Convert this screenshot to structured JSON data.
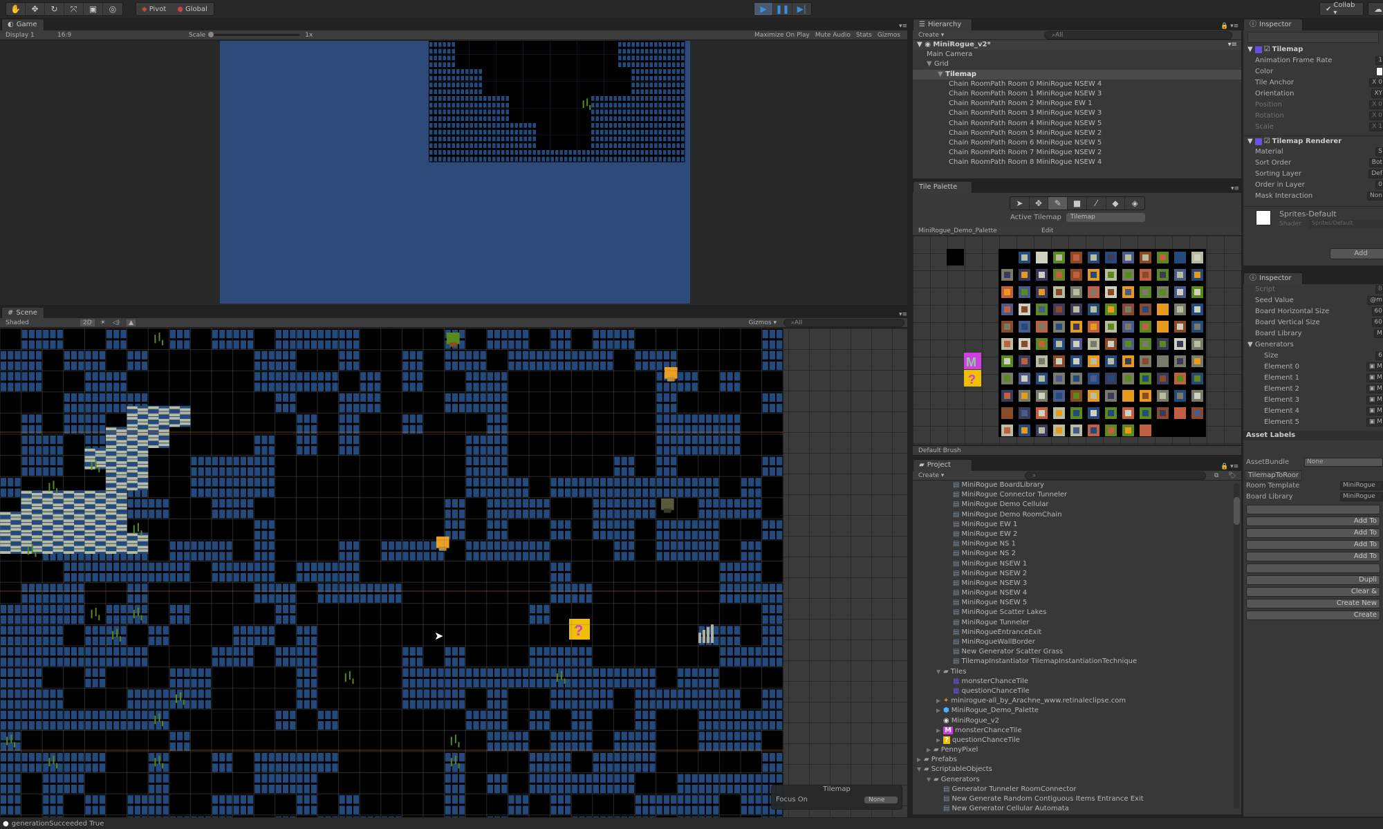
{
  "toolbar": {
    "tools": [
      "hand-tool",
      "move-tool",
      "rotate-tool",
      "scale-tool",
      "rect-tool",
      "transform-tool"
    ],
    "pivot_label": "Pivot",
    "global_label": "Global",
    "collab_label": "Collab ▾"
  },
  "game": {
    "tab_label": "Game",
    "display": "Display 1",
    "aspect": "16:9",
    "scale_label": "Scale",
    "scale_value": "1x",
    "maximize_label": "Maximize On Play",
    "mute_label": "Mute Audio",
    "stats_label": "Stats",
    "gizmos_label": "Gizmos",
    "bg_color": "#2d4a78"
  },
  "scene": {
    "tab_label": "Scene",
    "shading": "Shaded",
    "mode_2d": "2D",
    "gizmos_label": "Gizmos ▾",
    "search_placeholder": "All",
    "overlay_title": "Tilemap",
    "focus_label": "Focus On",
    "focus_value": "None"
  },
  "hierarchy": {
    "tab_label": "Hierarchy",
    "create_label": "Create ▾",
    "search_placeholder": "All",
    "scene_name": "MiniRogue_v2*",
    "items": [
      {
        "label": "Main Camera",
        "level": 1
      },
      {
        "label": "Grid",
        "level": 1,
        "expanded": true
      },
      {
        "label": "Tilemap",
        "level": 2,
        "expanded": true,
        "selected": true
      },
      {
        "label": "Chain RoomPath Room 0 MiniRogue NSEW 4",
        "level": 3
      },
      {
        "label": "Chain RoomPath Room 1 MiniRogue NSEW 3",
        "level": 3
      },
      {
        "label": "Chain RoomPath Room 2 MiniRogue EW 1",
        "level": 3
      },
      {
        "label": "Chain RoomPath Room 3 MiniRogue NSEW 3",
        "level": 3
      },
      {
        "label": "Chain RoomPath Room 4 MiniRogue NSEW 5",
        "level": 3
      },
      {
        "label": "Chain RoomPath Room 5 MiniRogue NSEW 2",
        "level": 3
      },
      {
        "label": "Chain RoomPath Room 6 MiniRogue NSEW 5",
        "level": 3
      },
      {
        "label": "Chain RoomPath Room 7 MiniRogue NSEW 2",
        "level": 3
      },
      {
        "label": "Chain RoomPath Room 8 MiniRogue NSEW 4",
        "level": 3
      }
    ]
  },
  "tile_palette": {
    "tab_label": "Tile Palette",
    "tools": [
      "select-tool",
      "move-tool",
      "paint-brush-tool",
      "box-fill-tool",
      "picker-tool",
      "eraser-tool",
      "fill-tool"
    ],
    "active_tilemap_label": "Active Tilemap",
    "active_tilemap_value": "Tilemap",
    "palette_name": "MiniRogue_Demo_Palette",
    "edit_label": "Edit",
    "brush_label": "Default Brush"
  },
  "project": {
    "tab_label": "Project",
    "create_label": "Create ▾",
    "items": [
      {
        "label": "MiniRogue BoardLibrary",
        "indent": 3,
        "icon": "asset"
      },
      {
        "label": "MiniRogue Connector Tunneler",
        "indent": 3,
        "icon": "asset"
      },
      {
        "label": "MiniRogue Demo Cellular",
        "indent": 3,
        "icon": "asset"
      },
      {
        "label": "MiniRogue Demo RoomChain",
        "indent": 3,
        "icon": "asset"
      },
      {
        "label": "MiniRogue EW 1",
        "indent": 3,
        "icon": "asset"
      },
      {
        "label": "MiniRogue EW 2",
        "indent": 3,
        "icon": "asset"
      },
      {
        "label": "MiniRogue NS 1",
        "indent": 3,
        "icon": "asset"
      },
      {
        "label": "MiniRogue NS 2",
        "indent": 3,
        "icon": "asset"
      },
      {
        "label": "MiniRogue NSEW 1",
        "indent": 3,
        "icon": "asset"
      },
      {
        "label": "MiniRogue NSEW 2",
        "indent": 3,
        "icon": "asset"
      },
      {
        "label": "MiniRogue NSEW 3",
        "indent": 3,
        "icon": "asset"
      },
      {
        "label": "MiniRogue NSEW 4",
        "indent": 3,
        "icon": "asset"
      },
      {
        "label": "MiniRogue NSEW 5",
        "indent": 3,
        "icon": "asset"
      },
      {
        "label": "MiniRogue Scatter Lakes",
        "indent": 3,
        "icon": "asset"
      },
      {
        "label": "MiniRogue Tunneler",
        "indent": 3,
        "icon": "asset"
      },
      {
        "label": "MiniRogueEntranceExit",
        "indent": 3,
        "icon": "asset"
      },
      {
        "label": "MiniRogueWallBorder",
        "indent": 3,
        "icon": "asset"
      },
      {
        "label": "New Generator Scatter Grass",
        "indent": 3,
        "icon": "asset"
      },
      {
        "label": "TilemapInstantiator TilemapInstantiationTechnique",
        "indent": 3,
        "icon": "asset"
      },
      {
        "label": "Tiles",
        "indent": 2,
        "icon": "folder",
        "arrow": "▼"
      },
      {
        "label": "monsterChanceTile",
        "indent": 3,
        "icon": "tile"
      },
      {
        "label": "questionChanceTile",
        "indent": 3,
        "icon": "tile"
      },
      {
        "label": "minirogue-all_by_Arachne_www.retinaleclipse.com",
        "indent": 2,
        "icon": "sprite",
        "arrow": "▶"
      },
      {
        "label": "MiniRogue_Demo_Palette",
        "indent": 2,
        "icon": "prefab",
        "arrow": "▶"
      },
      {
        "label": "MiniRogue_v2",
        "indent": 2,
        "icon": "scene"
      },
      {
        "label": "monsterChanceTile",
        "indent": 2,
        "icon": "m-tile",
        "arrow": "▶"
      },
      {
        "label": "questionChanceTile",
        "indent": 2,
        "icon": "q-tile",
        "arrow": "▶"
      },
      {
        "label": "PennyPixel",
        "indent": 1,
        "icon": "folder",
        "arrow": "▶"
      },
      {
        "label": "Prefabs",
        "indent": 0,
        "icon": "folder",
        "arrow": "▶"
      },
      {
        "label": "ScriptableObjects",
        "indent": 0,
        "icon": "folder",
        "arrow": "▼"
      },
      {
        "label": "Generators",
        "indent": 1,
        "icon": "folder",
        "arrow": "▼"
      },
      {
        "label": "Generator Tunneler RoomConnector",
        "indent": 2,
        "icon": "asset"
      },
      {
        "label": "New Generate Random Contiguous Items Entrance Exit",
        "indent": 2,
        "icon": "asset"
      },
      {
        "label": "New Generator Cellular Automata",
        "indent": 2,
        "icon": "asset"
      }
    ]
  },
  "inspector_top": {
    "tab_label": "Inspector",
    "tilemap_title": "Tilemap",
    "fields": [
      {
        "label": "Animation Frame Rate",
        "value": "1"
      },
      {
        "label": "Color",
        "value": ""
      },
      {
        "label": "Tile Anchor",
        "value": "X 0"
      },
      {
        "label": "Orientation",
        "value": "XY"
      },
      {
        "label": "Position",
        "value": "X 0",
        "dim": true
      },
      {
        "label": "Rotation",
        "value": "X 0",
        "dim": true
      },
      {
        "label": "Scale",
        "value": "X 1",
        "dim": true
      }
    ],
    "renderer_title": "Tilemap Renderer",
    "renderer_fields": [
      {
        "label": "Material",
        "value": "S"
      },
      {
        "label": "Sort Order",
        "value": "Bot"
      },
      {
        "label": "Sorting Layer",
        "value": "Def"
      },
      {
        "label": "Order in Layer",
        "value": "0"
      },
      {
        "label": "Mask Interaction",
        "value": "Non"
      }
    ],
    "material_name": "Sprites-Default",
    "shader_label": "Shader",
    "shader_value": "Sprites/Default",
    "add_component": "Add"
  },
  "inspector_bottom": {
    "tab_label": "Inspector",
    "fields": [
      {
        "label": "Script",
        "value": "B",
        "dim": true
      },
      {
        "label": "Seed Value",
        "value": "@m"
      },
      {
        "label": "Board Horizontal Size",
        "value": "60"
      },
      {
        "label": "Board Vertical Size",
        "value": "60"
      },
      {
        "label": "Board Library",
        "value": "M"
      }
    ],
    "generators_label": "Generators",
    "size_label": "Size",
    "size_value": "6",
    "elements": [
      "Element 0",
      "Element 1",
      "Element 2",
      "Element 3",
      "Element 4",
      "Element 5"
    ],
    "asset_labels": "Asset Labels",
    "assetbundle_label": "AssetBundle",
    "assetbundle_value": "None",
    "sub_tab": "TilemapToRoor",
    "room_template_label": "Room Template",
    "room_template_value": "MiniRogue",
    "board_library_label": "Board Library",
    "board_library_value": "MiniRogue",
    "buttons": [
      "",
      "Add To",
      "Add To",
      "Add To",
      "Add To",
      "",
      "Dupli",
      "Clear &",
      "Create New",
      "Create"
    ]
  },
  "status_bar": {
    "message": "generationSucceeded True"
  }
}
